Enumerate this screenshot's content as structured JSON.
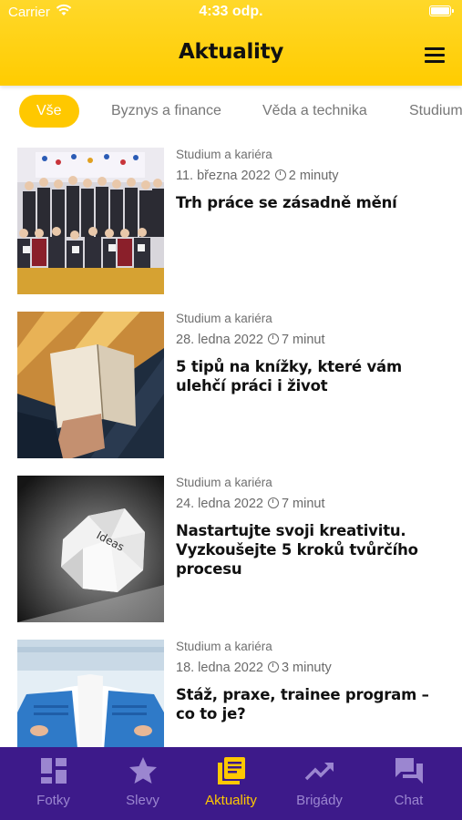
{
  "status_bar": {
    "carrier": "Carrier",
    "time": "4:33 odp."
  },
  "header": {
    "title": "Aktuality",
    "menu_icon": "hamburger-menu-icon"
  },
  "categories": [
    {
      "label": "Vše",
      "active": true
    },
    {
      "label": "Byznys a finance",
      "active": false
    },
    {
      "label": "Věda a technika",
      "active": false
    },
    {
      "label": "Studium",
      "active": false
    }
  ],
  "articles": [
    {
      "category": "Studium a kariéra",
      "date": "11. března 2022",
      "read_time": "2 minuty",
      "title": "Trh práce se zásadně mění",
      "image": "group-photo"
    },
    {
      "category": "Studium a kariéra",
      "date": "28. ledna 2022",
      "read_time": "7 minut",
      "title": "5 tipů na knížky, které vám ulehčí práci i život",
      "image": "book-in-hand"
    },
    {
      "category": "Studium a kariéra",
      "date": "24. ledna 2022",
      "read_time": "7 minut",
      "title": "Nastartujte svoji kreativitu. Vyzkoušejte 5 kroků tvůrčího procesu",
      "image": "crumpled-paper-ideas",
      "image_text": "Ideas"
    },
    {
      "category": "Studium a kariéra",
      "date": "18. ledna 2022",
      "read_time": "3 minuty",
      "title": "Stáž, praxe, trainee program – co to je?",
      "image": "laptops-on-desk"
    }
  ],
  "tab_bar": {
    "items": [
      {
        "label": "Fotky",
        "icon": "dashboard-grid-icon",
        "active": false
      },
      {
        "label": "Slevy",
        "icon": "star-icon",
        "active": false
      },
      {
        "label": "Aktuality",
        "icon": "news-list-icon",
        "active": true
      },
      {
        "label": "Brigády",
        "icon": "trending-up-icon",
        "active": false
      },
      {
        "label": "Chat",
        "icon": "chat-bubbles-icon",
        "active": false
      }
    ]
  },
  "colors": {
    "accent": "#ffc800",
    "header": "#ffd21a",
    "tab_bar": "#3d1a8a",
    "tab_inactive": "#9b86d0"
  }
}
